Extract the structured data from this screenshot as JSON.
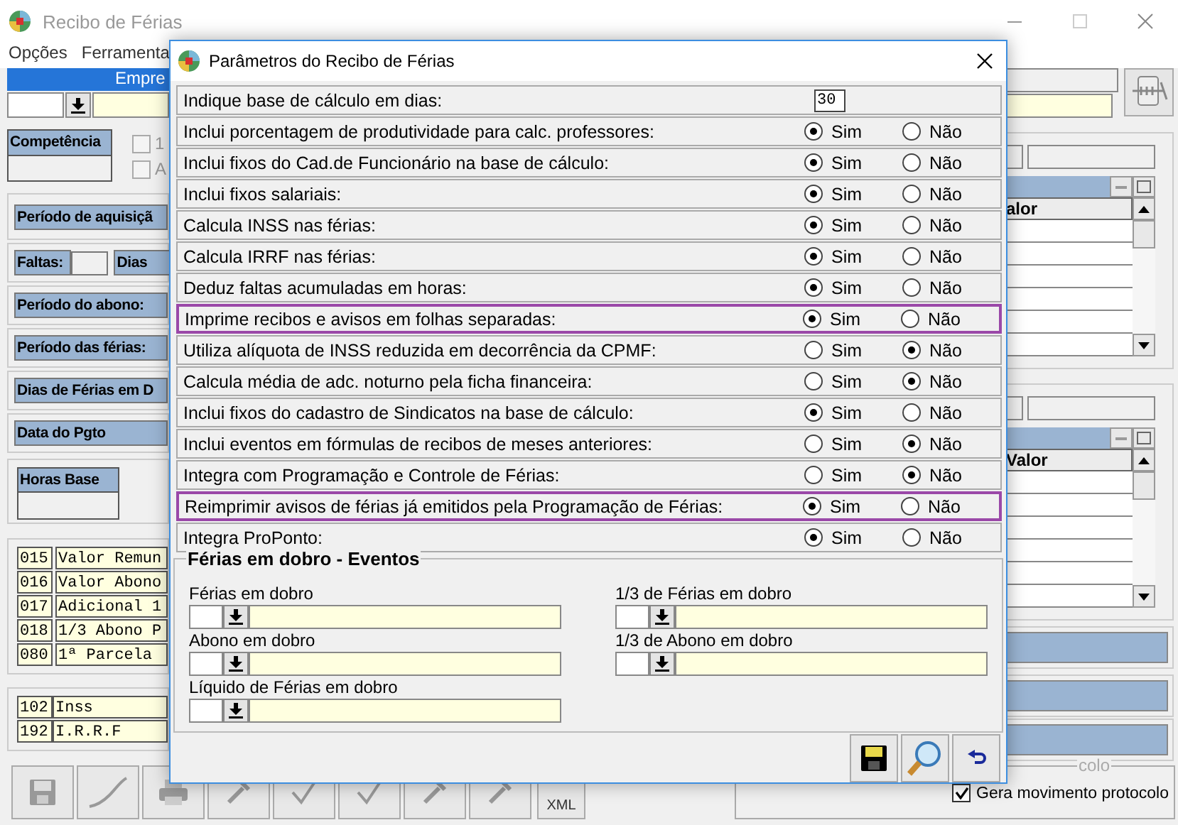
{
  "window": {
    "title": "Recibo de Férias"
  },
  "menu": [
    "Opções",
    "Ferramenta"
  ],
  "company": {
    "label": "Empre"
  },
  "competencia": {
    "label": "Competência"
  },
  "checkboxes": [
    {
      "label": "1",
      "checked": false
    },
    {
      "label": "A",
      "checked": false
    }
  ],
  "left_panels": [
    {
      "kind": "header",
      "label": "Período de aquisiçã"
    },
    {
      "kind": "pair",
      "label": "Faltas:",
      "label_2": "Dias"
    },
    {
      "kind": "header",
      "label": "Período do abono:"
    },
    {
      "kind": "header",
      "label": "Período das férias:"
    },
    {
      "kind": "header",
      "label": "Dias de Férias em D"
    },
    {
      "kind": "header",
      "label": "Data do Pgto"
    }
  ],
  "horas_base": {
    "label": "Horas Base"
  },
  "events": [
    {
      "code": "015",
      "description": "Valor Remun"
    },
    {
      "code": "016",
      "description": "Valor Abono"
    },
    {
      "code": "017",
      "description": "Adicional 1"
    },
    {
      "code": "018",
      "description": "1/3 Abono P"
    },
    {
      "code": "080",
      "description": "1ª Parcela"
    }
  ],
  "deductions": [
    {
      "code": "102",
      "description": "Inss"
    },
    {
      "code": "192",
      "description": "I.R.R.F"
    }
  ],
  "toolbar": [
    {
      "kind": "save"
    },
    {
      "kind": "signature"
    },
    {
      "kind": "print"
    },
    {
      "kind": "tool"
    },
    {
      "kind": "check"
    },
    {
      "kind": "check"
    },
    {
      "kind": "tool"
    },
    {
      "kind": "tool"
    },
    {
      "kind": "text",
      "label": "XML"
    }
  ],
  "right_grids": [
    {
      "header": "alor"
    },
    {
      "header": "Valor"
    }
  ],
  "protocol": {
    "legend": "colo",
    "label": "Gera movimento protocolo",
    "checked": true
  },
  "dialog": {
    "title": "Parâmetros do Recibo de Férias",
    "rows": [
      {
        "kind": "number",
        "label": "Indique base de cálculo em dias:",
        "value": "30",
        "highlighted": false
      },
      {
        "kind": "radio",
        "label": "Inclui porcentagem de produtividade para calc. professores:",
        "highlighted": false,
        "options": [
          {
            "label": "Sim",
            "selected": true
          },
          {
            "label": "Não",
            "selected": false
          }
        ]
      },
      {
        "kind": "radio",
        "label": "Inclui fixos do Cad.de Funcionário na base de cálculo:",
        "highlighted": false,
        "options": [
          {
            "label": "Sim",
            "selected": true
          },
          {
            "label": "Não",
            "selected": false
          }
        ]
      },
      {
        "kind": "radio",
        "label": "Inclui fixos salariais:",
        "highlighted": false,
        "options": [
          {
            "label": "Sim",
            "selected": true
          },
          {
            "label": "Não",
            "selected": false
          }
        ]
      },
      {
        "kind": "radio",
        "label": "Calcula INSS nas férias:",
        "highlighted": false,
        "options": [
          {
            "label": "Sim",
            "selected": true
          },
          {
            "label": "Não",
            "selected": false
          }
        ]
      },
      {
        "kind": "radio",
        "label": "Calcula IRRF nas férias:",
        "highlighted": false,
        "options": [
          {
            "label": "Sim",
            "selected": true
          },
          {
            "label": "Não",
            "selected": false
          }
        ]
      },
      {
        "kind": "radio",
        "label": "Deduz faltas acumuladas em horas:",
        "highlighted": false,
        "options": [
          {
            "label": "Sim",
            "selected": true
          },
          {
            "label": "Não",
            "selected": false
          }
        ]
      },
      {
        "kind": "radio",
        "label": "Imprime recibos e avisos em folhas separadas:",
        "highlighted": true,
        "options": [
          {
            "label": "Sim",
            "selected": true
          },
          {
            "label": "Não",
            "selected": false
          }
        ]
      },
      {
        "kind": "radio",
        "label": "Utiliza alíquota de INSS reduzida em decorrência da CPMF:",
        "highlighted": false,
        "options": [
          {
            "label": "Sim",
            "selected": false
          },
          {
            "label": "Não",
            "selected": true
          }
        ]
      },
      {
        "kind": "radio",
        "label": "Calcula média de adc. noturno pela ficha financeira:",
        "highlighted": false,
        "options": [
          {
            "label": "Sim",
            "selected": false
          },
          {
            "label": "Não",
            "selected": true
          }
        ]
      },
      {
        "kind": "radio",
        "label": "Inclui fixos do cadastro de Sindicatos na base de cálculo:",
        "highlighted": false,
        "options": [
          {
            "label": "Sim",
            "selected": true
          },
          {
            "label": "Não",
            "selected": false
          }
        ]
      },
      {
        "kind": "radio",
        "label": "Inclui eventos em fórmulas de recibos de meses anteriores:",
        "highlighted": false,
        "options": [
          {
            "label": "Sim",
            "selected": false
          },
          {
            "label": "Não",
            "selected": true
          }
        ]
      },
      {
        "kind": "radio",
        "label": "Integra com Programação e Controle de Férias:",
        "highlighted": false,
        "options": [
          {
            "label": "Sim",
            "selected": false
          },
          {
            "label": "Não",
            "selected": true
          }
        ]
      },
      {
        "kind": "radio",
        "label": "Reimprimir avisos de férias já emitidos pela Programação de Férias:",
        "highlighted": true,
        "options": [
          {
            "label": "Sim",
            "selected": true
          },
          {
            "label": "Não",
            "selected": false
          }
        ]
      },
      {
        "kind": "radio",
        "label": "Integra ProPonto:",
        "highlighted": false,
        "options": [
          {
            "label": "Sim",
            "selected": true
          },
          {
            "label": "Não",
            "selected": false
          }
        ]
      }
    ],
    "group": {
      "title": "Férias em dobro - Eventos",
      "fields": [
        {
          "label": "Férias em dobro"
        },
        {
          "label": "1/3 de Férias em dobro"
        },
        {
          "label": "Abono em dobro"
        },
        {
          "label": "1/3 de Abono em dobro"
        },
        {
          "label": "Líquido de Férias em dobro"
        }
      ]
    },
    "buttons": [
      {
        "kind": "save"
      },
      {
        "kind": "search"
      },
      {
        "kind": "undo"
      }
    ]
  }
}
